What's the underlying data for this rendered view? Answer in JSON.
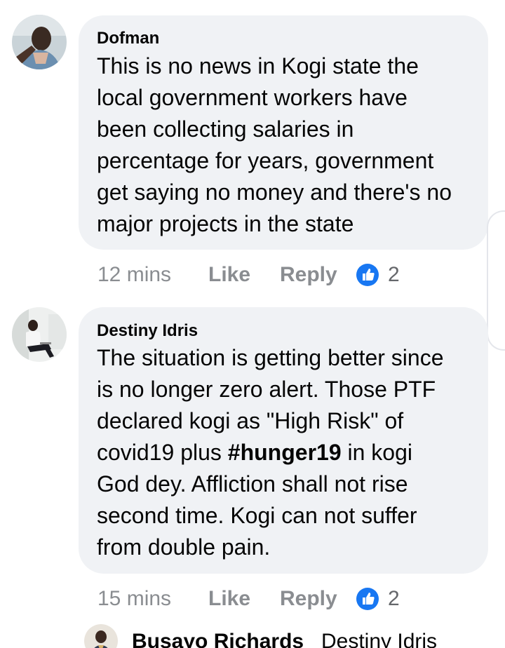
{
  "comments": [
    {
      "author": "Dofman",
      "lines": [
        "This is no news in Kogi state the",
        "local government workers have",
        "been collecting salaries in",
        "percentage for years, government",
        "get saying no money and there's no",
        "major projects in the state"
      ],
      "time": "12 mins",
      "like_label": "Like",
      "reply_label": "Reply",
      "reaction_icon": "thumbs-up-icon",
      "reaction_count": "2"
    },
    {
      "author": "Destiny Idris",
      "lines": [
        "The situation is getting better since",
        "is no longer zero alert. Those PTF",
        "declared kogi as \"High Risk\" of"
      ],
      "line4_pre": "covid19 plus ",
      "line4_hashtag": "#hunger19",
      "line4_post": " in kogi",
      "lines_after": [
        "God dey. Affliction shall not rise",
        "second time. Kogi can not suffer",
        "from double pain."
      ],
      "time": "15 mins",
      "like_label": "Like",
      "reply_label": "Reply",
      "reaction_icon": "thumbs-up-icon",
      "reaction_count": "2"
    }
  ],
  "reply_preview": {
    "author": "Busayo Richards",
    "mention": "Destiny Idris"
  },
  "colors": {
    "bubble": "#f0f2f5",
    "text": "#050505",
    "meta": "#8a8d91",
    "like_blue": "#1877f2"
  }
}
